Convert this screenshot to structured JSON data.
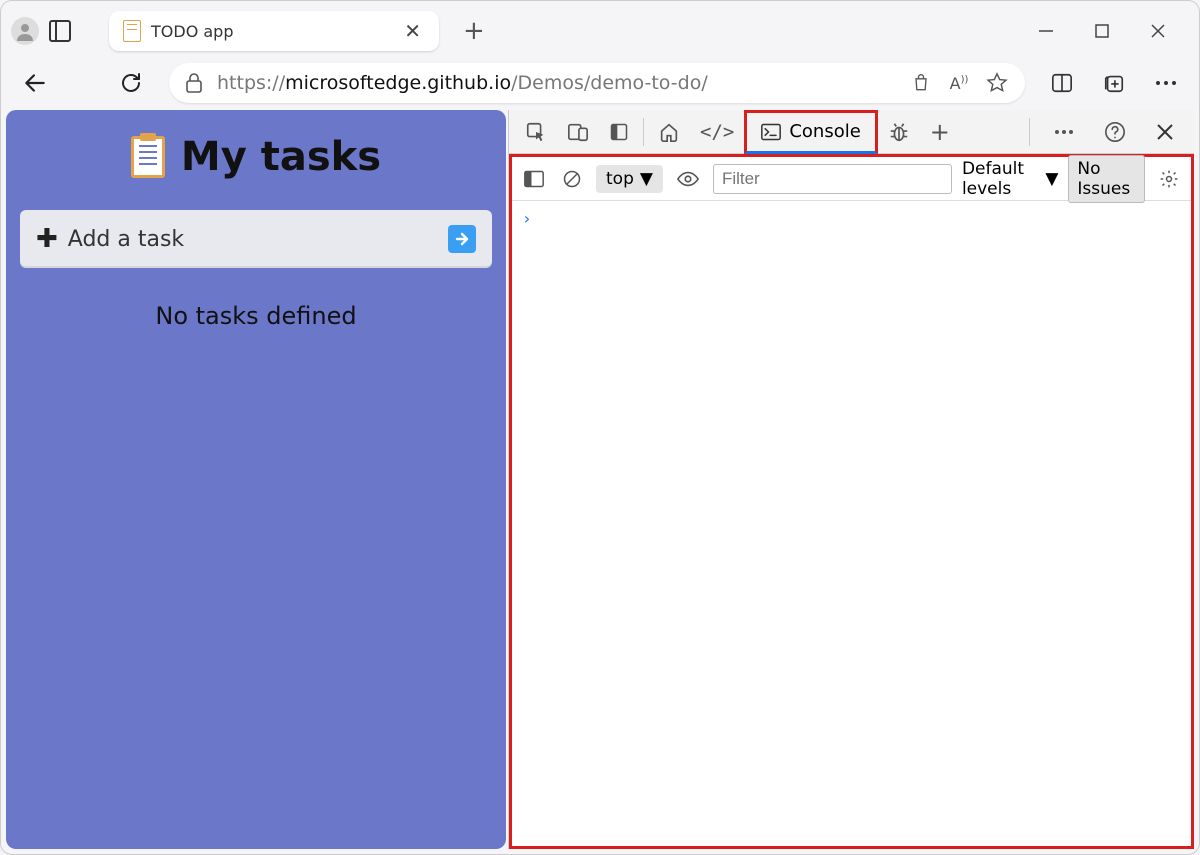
{
  "browser": {
    "tab_title": "TODO app",
    "url_prefix": "https://",
    "url_host": "microsoftedge.github.io",
    "url_path": "/Demos/demo-to-do/"
  },
  "page": {
    "title": "My tasks",
    "add_task_placeholder": "Add a task",
    "empty_message": "No tasks defined"
  },
  "devtools": {
    "console_tab_label": "Console",
    "context": "top",
    "filter_placeholder": "Filter",
    "levels_label": "Default levels",
    "issues_label": "No Issues",
    "prompt_symbol": "›"
  }
}
